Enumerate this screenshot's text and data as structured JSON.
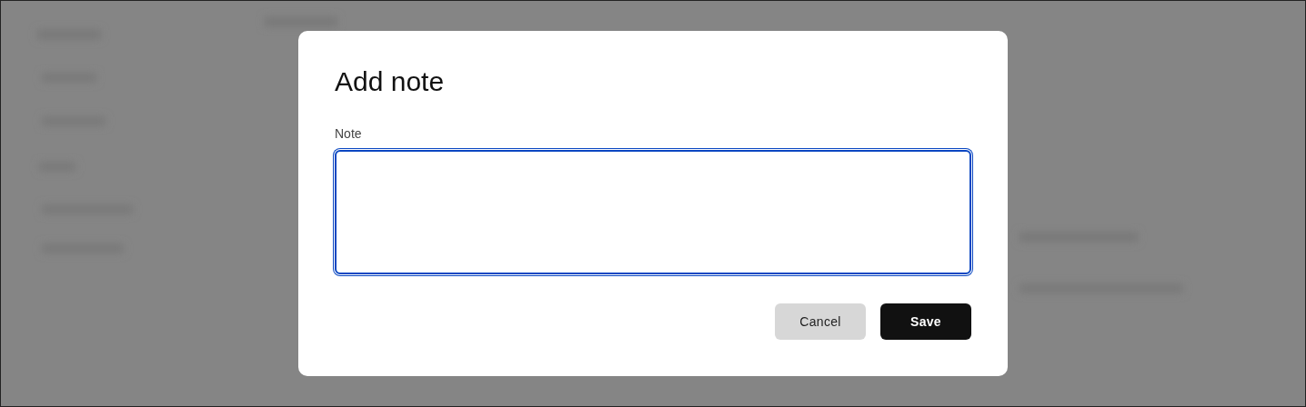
{
  "dialog": {
    "title": "Add note",
    "field": {
      "label": "Note",
      "focused": true
    },
    "buttons": [
      {
        "label": "Cancel",
        "kind": "secondary"
      },
      {
        "label": "Save",
        "kind": "primary"
      }
    ]
  }
}
